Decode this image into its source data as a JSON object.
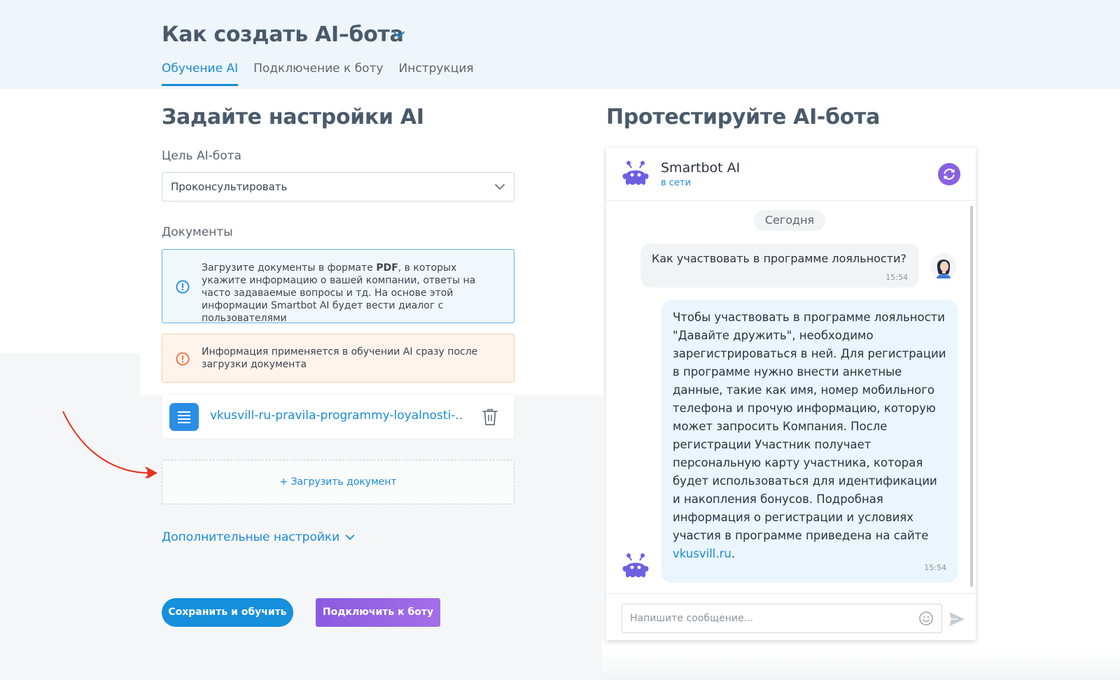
{
  "header": {
    "title": "Как создать AI–бота",
    "tabs": [
      {
        "label": "Обучение AI",
        "active": true
      },
      {
        "label": "Подключение к боту",
        "active": false
      },
      {
        "label": "Инструкция",
        "active": false
      }
    ]
  },
  "settings": {
    "title": "Задайте настройки AI",
    "goal_label": "Цель AI-бота",
    "goal_value": "Проконсультировать",
    "docs_label": "Документы",
    "info_text_1": "Загрузите документы в формате ",
    "info_text_bold": "PDF",
    "info_text_2": ", в которых укажите информацию о вашей компании, ответы на часто задаваемые вопросы и тд. На основе этой информации Smartbot AI будет вести диалог с пользователями",
    "warn_text": "Информация применяется в обучении AI сразу после загрузки документа",
    "file_name": "vkusvill-ru-pravila-programmy-loyalnosti-....",
    "upload_label": "+ Загрузить документ",
    "more_settings_label": "Дополнительные настройки",
    "save_button": "Сохранить и обучить",
    "connect_button": "Подключить к боту"
  },
  "test": {
    "title": "Протестируйте AI-бота",
    "bot_name": "Smartbot AI",
    "bot_status": "в сети",
    "date_divider": "Сегодня",
    "user_message": "Как участвовать в программе лояльности?",
    "user_time": "15:54",
    "bot_message": "Чтобы участвовать в программе лояльности \"Давайте дружить\", необходимо зарегистрироваться в ней. Для регистрации в программе нужно внести анкетные данные, такие как имя, номер мобильного телефона и прочую информацию, которую может запросить Компания. После регистрации Участник получает персональную карту участника, которая будет использоваться для идентификации и накопления бонусов. Подробная информация о регистрации и условиях участия в программе приведена на сайте",
    "bot_link": "vkusvill.ru",
    "bot_tail": ".",
    "bot_time": "15:54",
    "input_placeholder": "Напишите сообщение..."
  },
  "colors": {
    "accent": "#1a8ad8",
    "header_bg": "#eef6fb",
    "purple": "#8a5fe3",
    "info_border": "#5fb2ec",
    "warn_border": "#f5cfaa",
    "arrow": "#e8301c"
  },
  "icons": {
    "title_chevron": "chevron-down-icon",
    "info": "info-circle-icon",
    "warning": "warning-circle-icon",
    "file": "document-icon",
    "trash": "trash-icon",
    "refresh": "refresh-icon",
    "emoji": "emoji-icon",
    "send": "send-icon",
    "bot_avatar": "robot-avatar-icon",
    "user_avatar": "user-avatar-icon"
  }
}
